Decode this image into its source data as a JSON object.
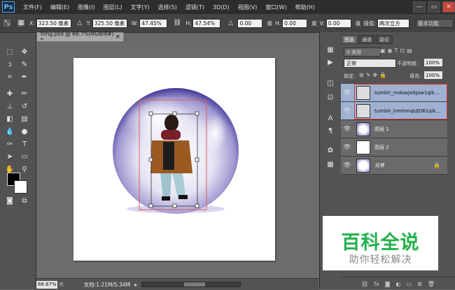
{
  "app": {
    "logo": "Ps"
  },
  "menu": [
    "文件(F)",
    "编辑(E)",
    "图像(I)",
    "图层(L)",
    "文字(Y)",
    "选择(S)",
    "滤镜(T)",
    "3D(D)",
    "视图(V)",
    "窗口(W)",
    "帮助(H)"
  ],
  "window_controls": {
    "minimize": "—",
    "maximize": "▭",
    "close": "✕"
  },
  "options": {
    "x_label": "X:",
    "x_value": "323.50 像素",
    "y_label": "Y:",
    "y_value": "325.50 像素",
    "w_label": "W:",
    "w_value": "47.45%",
    "h_label": "H:",
    "h_value": "47.54%",
    "angle_value": "0.00",
    "angle_unit": "度",
    "hskew_label": "H:",
    "hskew_value": "0.00",
    "hskew_unit": "度",
    "vskew_label": "V:",
    "vskew_value": "0.00",
    "vskew_unit": "度",
    "interp_label": "插值:",
    "interp_value": "两次立方",
    "workspace": "基本功能"
  },
  "document": {
    "tab_title": "timg.psd @ 66.7%(RGB/8#) *",
    "close": "×"
  },
  "status": {
    "zoom": "66.67%",
    "doc_info": "文档:1.21M/5.34M"
  },
  "layers_panel": {
    "tabs": [
      "图层",
      "通道",
      "路径"
    ],
    "filter_label": "类型",
    "blend_mode": "正常",
    "opacity_label": "不透明度:",
    "opacity_value": "100%",
    "lock_label": "锁定:",
    "fill_label": "填充:",
    "fill_value": "100%",
    "layers": [
      {
        "name": "tumblr_mdowje0piw1qik...",
        "selected": true
      },
      {
        "name": "tumblr_lnmhmqUJD61qik...",
        "selected": true
      },
      {
        "name": "图层 1",
        "selected": false
      },
      {
        "name": "图层 2",
        "selected": false
      },
      {
        "name": "背景",
        "selected": false
      }
    ],
    "footer_icons": [
      "link-icon",
      "fx-icon",
      "mask-icon",
      "adjust-icon",
      "folder-icon",
      "new-layer-icon",
      "trash-icon"
    ],
    "footer_text": {
      "fx": "fx"
    }
  },
  "watermark": {
    "title": "百科全说",
    "subtitle": "助你轻松解决",
    "title_color": "#22b14c"
  }
}
